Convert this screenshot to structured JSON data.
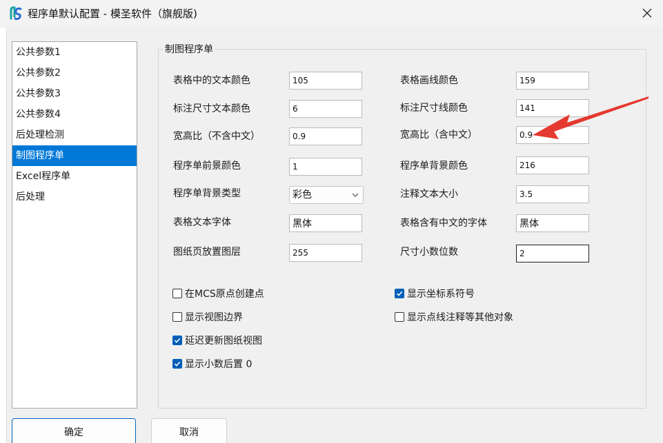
{
  "window": {
    "title": "程序单默认配置 - 模圣软件（旗舰版)"
  },
  "nav": {
    "items": [
      {
        "label": "公共参数1",
        "selected": false
      },
      {
        "label": "公共参数2",
        "selected": false
      },
      {
        "label": "公共参数3",
        "selected": false
      },
      {
        "label": "公共参数4",
        "selected": false
      },
      {
        "label": "后处理检测",
        "selected": false
      },
      {
        "label": "制图程序单",
        "selected": true
      },
      {
        "label": "Excel程序单",
        "selected": false
      },
      {
        "label": "后处理",
        "selected": false
      }
    ]
  },
  "group": {
    "title": "制图程序单"
  },
  "fields": {
    "table_text_color": {
      "label": "表格中的文本颜色",
      "value": "105"
    },
    "table_line_color": {
      "label": "表格画线颜色",
      "value": "159"
    },
    "dim_text_color": {
      "label": "标注尺寸文本颜色",
      "value": "6"
    },
    "dim_line_color": {
      "label": "标注尺寸线颜色",
      "value": "141"
    },
    "aspect_no_cn": {
      "label": "宽高比（不含中文）",
      "value": "0.9"
    },
    "aspect_cn": {
      "label": "宽高比（含中文）",
      "value": "0.9"
    },
    "fg_color": {
      "label": "程序单前景颜色",
      "value": "1"
    },
    "bg_color": {
      "label": "程序单背景颜色",
      "value": "216"
    },
    "bg_type": {
      "label": "程序单背景类型",
      "value": "彩色"
    },
    "note_size": {
      "label": "注释文本大小",
      "value": "3.5"
    },
    "table_font": {
      "label": "表格文本字体",
      "value": "黑体"
    },
    "table_cn_font": {
      "label": "表格含有中文的字体",
      "value": "黑体"
    },
    "layer": {
      "label": "图纸页放置图层",
      "value": "255"
    },
    "decimals": {
      "label": "尺寸小数位数",
      "value": "2"
    }
  },
  "checkboxes": {
    "mcs_origin": {
      "label": "在MCS原点创建点",
      "checked": false
    },
    "show_csys": {
      "label": "显示坐标系符号",
      "checked": true
    },
    "view_border": {
      "label": "显示视图边界",
      "checked": false
    },
    "show_other": {
      "label": "显示点线注释等其他对象",
      "checked": false
    },
    "delay_update": {
      "label": "延迟更新图纸视图",
      "checked": true
    },
    "trailing_zero": {
      "label": "显示小数后置 0",
      "checked": true
    }
  },
  "buttons": {
    "ok": "确定",
    "cancel": "取消"
  },
  "colors": {
    "selection": "#0078d7",
    "checkbox_checked": "#005fb8",
    "arrow": "#e5392f"
  },
  "icons": {
    "app": "app-logo-icon",
    "close": "close-icon",
    "dropdown": "chevron-down-icon",
    "check": "checkmark-icon",
    "arrow": "red-arrow-annotation"
  }
}
